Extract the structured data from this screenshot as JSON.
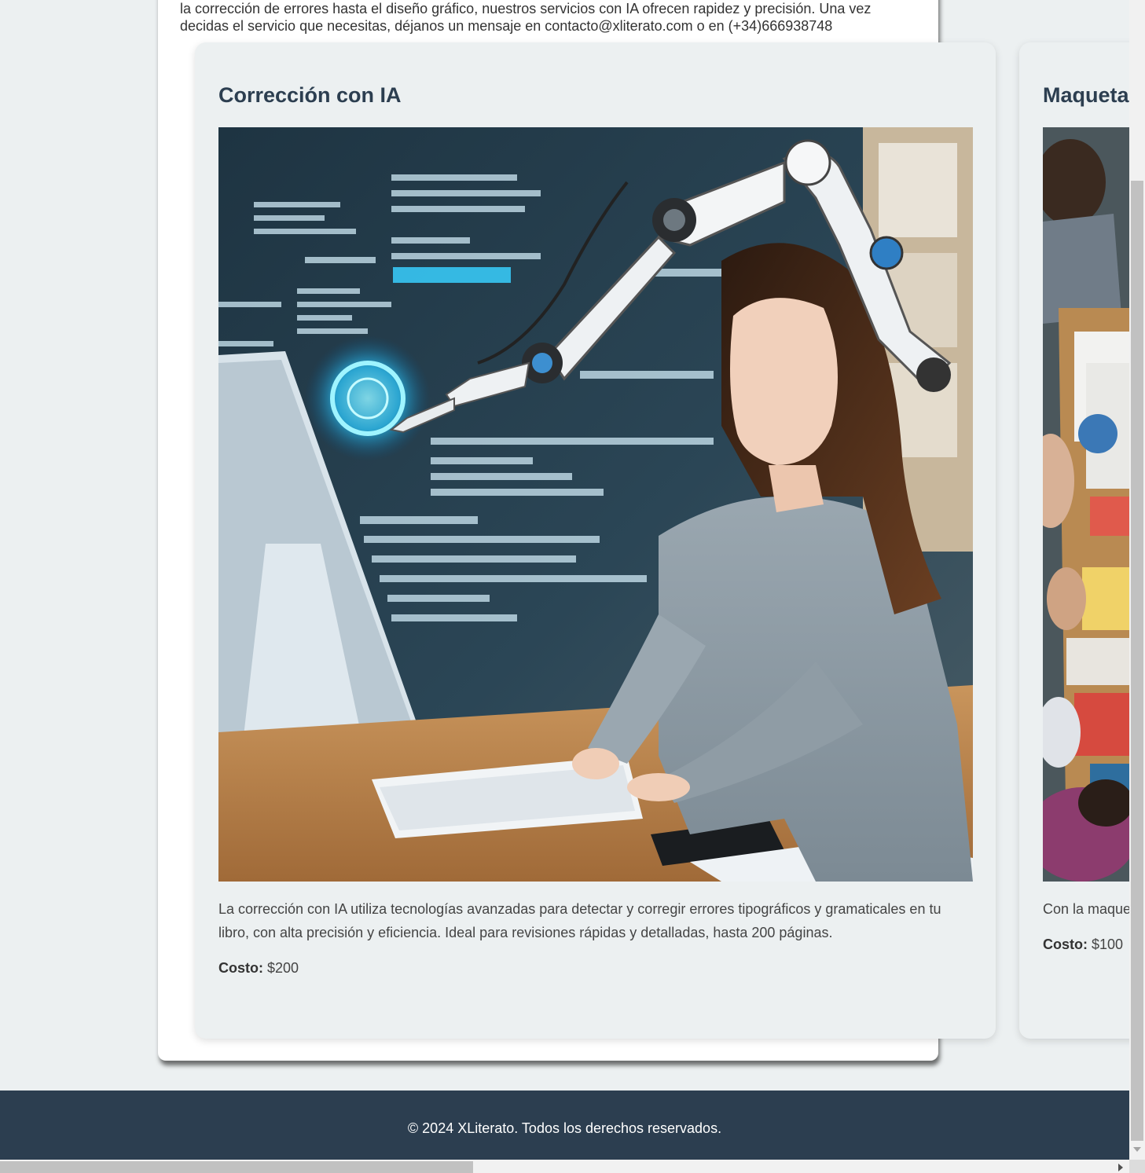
{
  "intro": {
    "text": "la corrección de errores hasta el diseño gráfico, nuestros servicios con IA ofrecen rapidez y precisión. Una vez decidas el servicio que necesitas, déjanos un mensaje en contacto@xliterato.com o en (+34)666938748"
  },
  "services": [
    {
      "title": "Corrección con IA",
      "description": "La corrección con IA utiliza tecnologías avanzadas para detectar y corregir errores tipográficos y gramaticales en tu libro, con alta precisión y eficiencia. Ideal para revisiones rápidas y detalladas, hasta 200 páginas.",
      "cost_label": "Costo:",
      "cost_value": " $200"
    },
    {
      "title": "Maqueta",
      "description": "Con la maque tipografía ade publicaciones",
      "cost_label": "Costo:",
      "cost_value": " $100"
    }
  ],
  "footer": {
    "text": "© 2024 XLiterato. Todos los derechos reservados."
  }
}
